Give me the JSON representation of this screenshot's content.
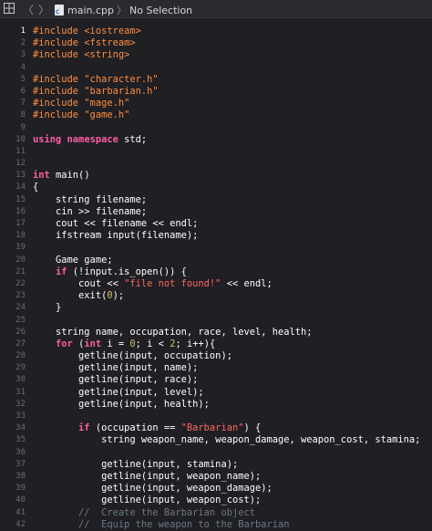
{
  "toolbar": {
    "file_name": "main.cpp",
    "separator": "〉",
    "selection": "No Selection",
    "back_glyph": "〈",
    "forward_glyph": "〉",
    "file_icon_letter": "C",
    "grid_icon": "grid-icon",
    "file_icon": "cpp-file-icon"
  },
  "editor": {
    "active_line": 1,
    "colors": {
      "background": "#1f1f24",
      "line_number": "#6c6c70",
      "preprocessor": "#fd8f3f",
      "keyword": "#fc5fa3",
      "string": "#fc6a5d",
      "number": "#d0bf69",
      "comment": "#6c7986",
      "plain": "#ffffff"
    },
    "lines": [
      {
        "n": "1",
        "tokens": [
          [
            "pp",
            "#include <iostream>"
          ]
        ]
      },
      {
        "n": "2",
        "tokens": [
          [
            "pp",
            "#include <fstream>"
          ]
        ]
      },
      {
        "n": "3",
        "tokens": [
          [
            "pp",
            "#include <string>"
          ]
        ]
      },
      {
        "n": "4",
        "tokens": []
      },
      {
        "n": "5",
        "tokens": [
          [
            "pp",
            "#include \"character.h\""
          ]
        ]
      },
      {
        "n": "6",
        "tokens": [
          [
            "pp",
            "#include \"barbarian.h\""
          ]
        ]
      },
      {
        "n": "7",
        "tokens": [
          [
            "pp",
            "#include \"mage.h\""
          ]
        ]
      },
      {
        "n": "8",
        "tokens": [
          [
            "pp",
            "#include \"game.h\""
          ]
        ]
      },
      {
        "n": "9",
        "tokens": []
      },
      {
        "n": "10",
        "tokens": [
          [
            "kw",
            "using"
          ],
          [
            "p",
            " "
          ],
          [
            "kw",
            "namespace"
          ],
          [
            "p",
            " std;"
          ]
        ]
      },
      {
        "n": "11",
        "tokens": []
      },
      {
        "n": "12",
        "tokens": []
      },
      {
        "n": "13",
        "tokens": [
          [
            "kw",
            "int"
          ],
          [
            "p",
            " main()"
          ]
        ]
      },
      {
        "n": "14",
        "tokens": [
          [
            "p",
            "{"
          ]
        ]
      },
      {
        "n": "15",
        "tokens": [
          [
            "p",
            "    string filename;"
          ]
        ]
      },
      {
        "n": "16",
        "tokens": [
          [
            "p",
            "    cin >> filename;"
          ]
        ]
      },
      {
        "n": "17",
        "tokens": [
          [
            "p",
            "    cout << filename << endl;"
          ]
        ]
      },
      {
        "n": "18",
        "tokens": [
          [
            "p",
            "    ifstream input(filename);"
          ]
        ]
      },
      {
        "n": "19",
        "tokens": []
      },
      {
        "n": "20",
        "tokens": [
          [
            "p",
            "    Game game;"
          ]
        ]
      },
      {
        "n": "21",
        "tokens": [
          [
            "p",
            "    "
          ],
          [
            "kw",
            "if"
          ],
          [
            "p",
            " (!input.is_open()) {"
          ]
        ]
      },
      {
        "n": "22",
        "tokens": [
          [
            "p",
            "        cout << "
          ],
          [
            "str",
            "\"file not found!\""
          ],
          [
            "p",
            " << endl;"
          ]
        ]
      },
      {
        "n": "23",
        "tokens": [
          [
            "p",
            "        exit("
          ],
          [
            "num",
            "0"
          ],
          [
            "p",
            ");"
          ]
        ]
      },
      {
        "n": "24",
        "tokens": [
          [
            "p",
            "    }"
          ]
        ]
      },
      {
        "n": "25",
        "tokens": []
      },
      {
        "n": "26",
        "tokens": [
          [
            "p",
            "    string name, occupation, race, level, health;"
          ]
        ]
      },
      {
        "n": "27",
        "tokens": [
          [
            "p",
            "    "
          ],
          [
            "kw",
            "for"
          ],
          [
            "p",
            " ("
          ],
          [
            "kw",
            "int"
          ],
          [
            "p",
            " i = "
          ],
          [
            "num",
            "0"
          ],
          [
            "p",
            "; i < "
          ],
          [
            "num",
            "2"
          ],
          [
            "p",
            "; i++){"
          ]
        ]
      },
      {
        "n": "28",
        "tokens": [
          [
            "p",
            "        getline(input, occupation);"
          ]
        ]
      },
      {
        "n": "29",
        "tokens": [
          [
            "p",
            "        getline(input, name);"
          ]
        ]
      },
      {
        "n": "30",
        "tokens": [
          [
            "p",
            "        getline(input, race);"
          ]
        ]
      },
      {
        "n": "31",
        "tokens": [
          [
            "p",
            "        getline(input, level);"
          ]
        ]
      },
      {
        "n": "32",
        "tokens": [
          [
            "p",
            "        getline(input, health);"
          ]
        ]
      },
      {
        "n": "33",
        "tokens": []
      },
      {
        "n": "34",
        "tokens": [
          [
            "p",
            "        "
          ],
          [
            "kw",
            "if"
          ],
          [
            "p",
            " (occupation == "
          ],
          [
            "str",
            "\"Barbarian\""
          ],
          [
            "p",
            ") {"
          ]
        ]
      },
      {
        "n": "35",
        "tokens": [
          [
            "p",
            "            string weapon_name, weapon_damage, weapon_cost, stamina;"
          ]
        ]
      },
      {
        "n": "36",
        "tokens": []
      },
      {
        "n": "37",
        "tokens": [
          [
            "p",
            "            getline(input, stamina);"
          ]
        ]
      },
      {
        "n": "38",
        "tokens": [
          [
            "p",
            "            getline(input, weapon_name);"
          ]
        ]
      },
      {
        "n": "39",
        "tokens": [
          [
            "p",
            "            getline(input, weapon_damage);"
          ]
        ]
      },
      {
        "n": "40",
        "tokens": [
          [
            "p",
            "            getline(input, weapon_cost);"
          ]
        ]
      },
      {
        "n": "41",
        "tokens": [
          [
            "p",
            "        "
          ],
          [
            "cmt",
            "//  Create the Barbarian object"
          ]
        ]
      },
      {
        "n": "42",
        "tokens": [
          [
            "p",
            "        "
          ],
          [
            "cmt",
            "//  Equip the weapon to the Barbarian"
          ]
        ]
      }
    ]
  }
}
